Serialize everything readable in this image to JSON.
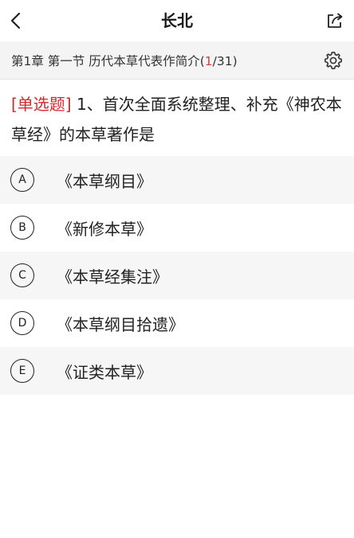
{
  "header": {
    "title": "长北",
    "back_icon": "chevron-left-icon",
    "share_icon": "share-icon"
  },
  "chapter": {
    "label": "第1章 第一节 历代本草代表作简介",
    "progress_open": "(",
    "progress_current": "1",
    "progress_rest": "/31)",
    "settings_icon": "gear-icon"
  },
  "question": {
    "type_label": "[单选题]",
    "text": " 1、首次全面系统整理、补充《神农本草经》的本草著作是"
  },
  "options": [
    {
      "letter": "A",
      "text": "《本草纲目》"
    },
    {
      "letter": "B",
      "text": "《新修本草》"
    },
    {
      "letter": "C",
      "text": "《本草经集注》"
    },
    {
      "letter": "D",
      "text": "《本草纲目拾遗》"
    },
    {
      "letter": "E",
      "text": "《证类本草》"
    }
  ],
  "colors": {
    "accent_red": "#d4282d",
    "chapter_bg": "#f4f4f4",
    "option_alt_bg": "#f6f6f6"
  }
}
